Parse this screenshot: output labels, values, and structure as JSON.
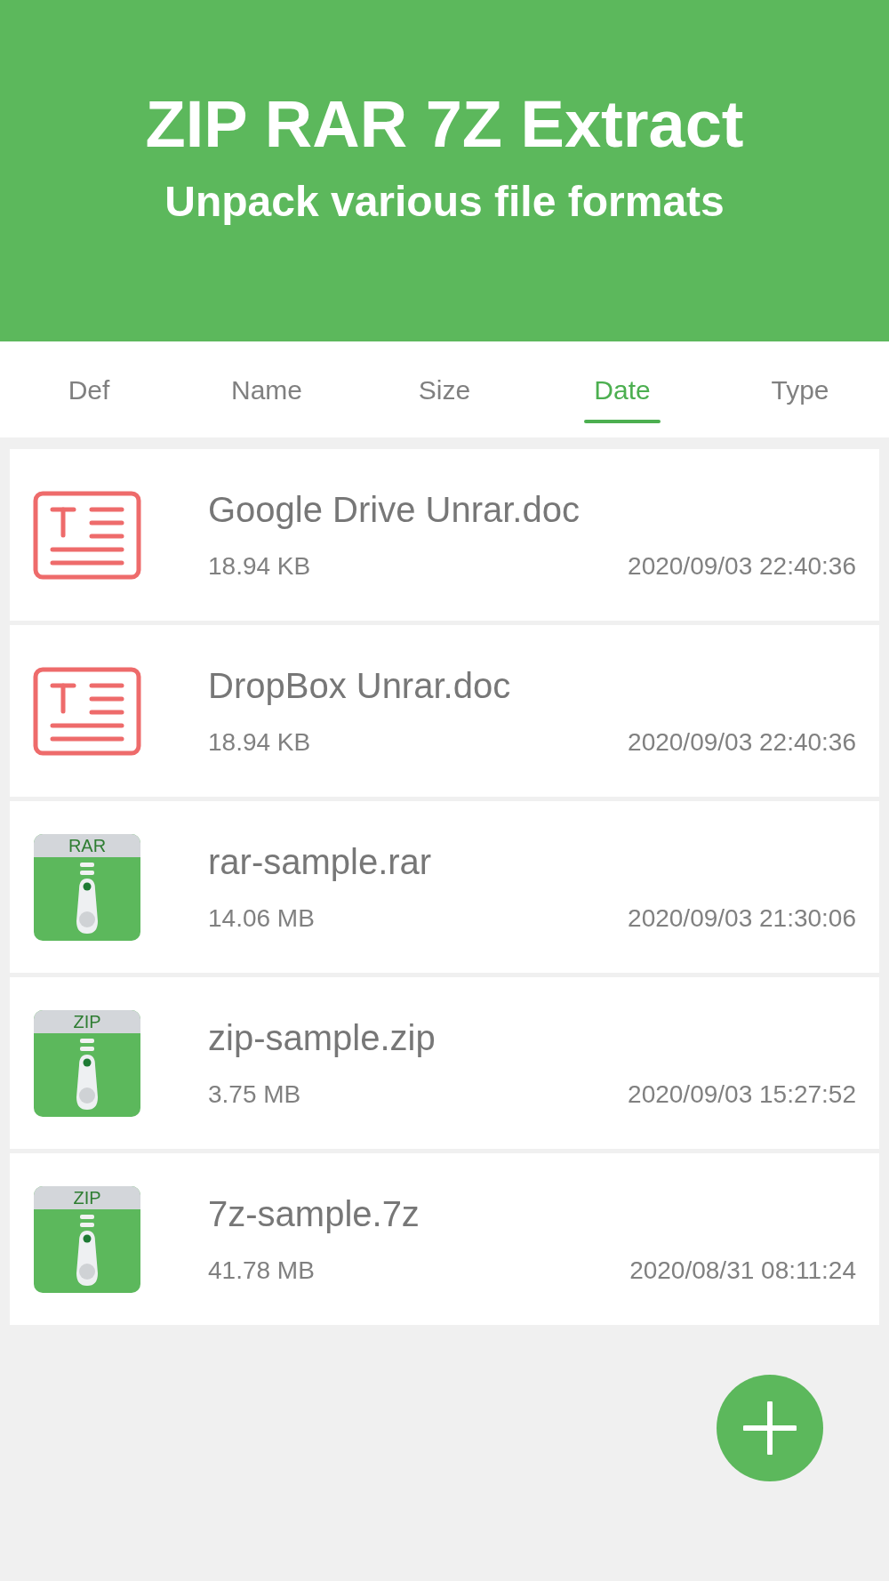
{
  "header": {
    "title": "ZIP RAR 7Z Extract",
    "subtitle": "Unpack various file formats"
  },
  "tabs": [
    {
      "label": "Def",
      "selected": false
    },
    {
      "label": "Name",
      "selected": false
    },
    {
      "label": "Size",
      "selected": false
    },
    {
      "label": "Date",
      "selected": true
    },
    {
      "label": "Type",
      "selected": false
    }
  ],
  "files": [
    {
      "kind": "document",
      "name": "Google Drive Unrar.doc",
      "size": "18.94 KB",
      "date": "2020/09/03 22:40:36"
    },
    {
      "kind": "document",
      "name": "DropBox Unrar.doc",
      "size": "18.94 KB",
      "date": "2020/09/03 22:40:36"
    },
    {
      "kind": "archive",
      "icon_label": "RAR",
      "name": "rar-sample.rar",
      "size": "14.06 MB",
      "date": "2020/09/03 21:30:06"
    },
    {
      "kind": "archive",
      "icon_label": "ZIP",
      "name": "zip-sample.zip",
      "size": "3.75 MB",
      "date": "2020/09/03 15:27:52"
    },
    {
      "kind": "archive",
      "icon_label": "ZIP",
      "name": "7z-sample.7z",
      "size": "41.78 MB",
      "date": "2020/08/31 08:11:24"
    }
  ]
}
